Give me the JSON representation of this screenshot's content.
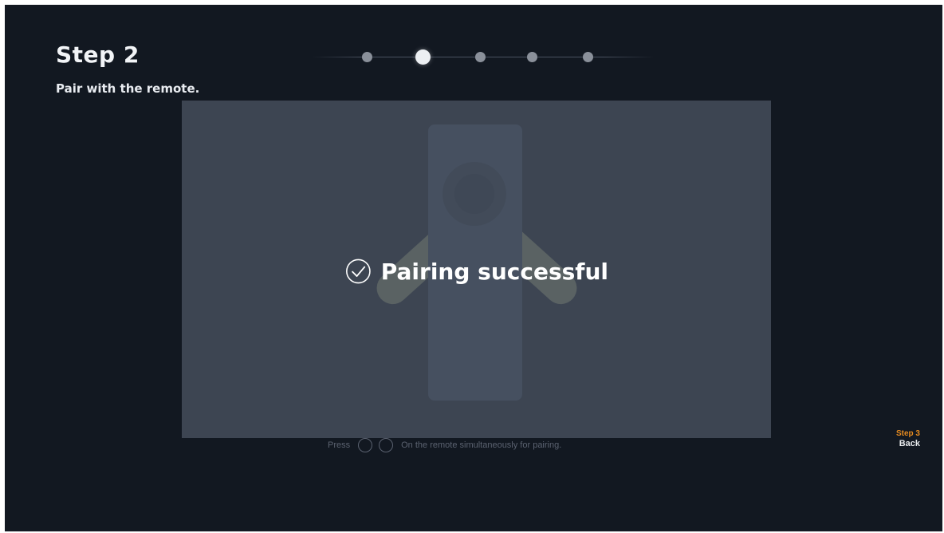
{
  "header": {
    "title": "Step 2",
    "subtitle": "Pair with the remote."
  },
  "progress": {
    "total_steps": 5,
    "current_step": 2
  },
  "status": {
    "message": "Pairing successful",
    "icon": "check-circle-icon"
  },
  "instruction": {
    "prefix": "Press",
    "suffix": "On the remote simultaneously for pairing."
  },
  "navigation": {
    "next_label": "Step 3",
    "back_label": "Back"
  },
  "colors": {
    "background": "#121821",
    "panel": "#3d4552",
    "accent": "#e58a1f",
    "text": "#ffffff"
  }
}
